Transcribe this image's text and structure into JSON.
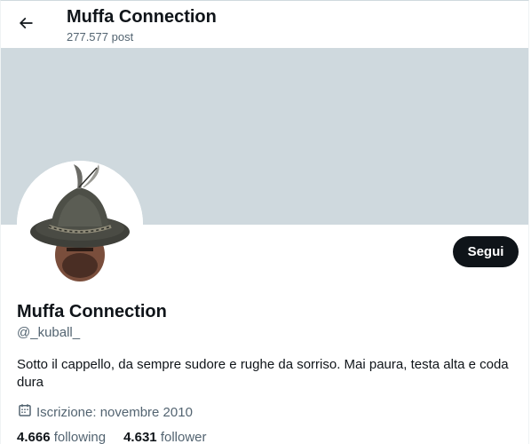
{
  "header": {
    "title": "Muffa Connection",
    "post_count": "277.577 post",
    "back_icon": "arrow-left-icon"
  },
  "profile": {
    "display_name": "Muffa Connection",
    "handle": "@_kuball_",
    "bio": "Sotto il cappello, da sempre sudore e rughe da sorriso. Mai paura, testa alta e coda dura",
    "joined": "Iscrizione: novembre 2010",
    "joined_icon": "calendar-icon",
    "following_count": "4.666",
    "following_label": "following",
    "follower_count": "4.631",
    "follower_label": "follower"
  },
  "actions": {
    "follow_label": "Segui"
  },
  "colors": {
    "banner": "#cfd9de",
    "primary_text": "#0f1419",
    "secondary_text": "#536471",
    "button_bg": "#0f1419",
    "button_text": "#ffffff"
  }
}
